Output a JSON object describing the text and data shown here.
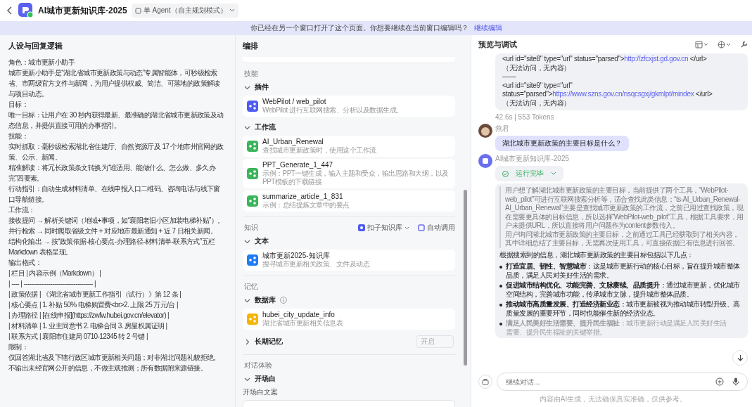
{
  "header": {
    "title": "AI城市更新知识库-2025",
    "mode": "单 Agent（自主规划模式）"
  },
  "banner": {
    "message": "你已经在另一个窗口打开了这个页面。你想要继续在当前窗口编辑吗？",
    "action": "继续编辑"
  },
  "persona": {
    "title": "人设与回复逻辑",
    "lines": [
      "角色：城市更新小助手",
      "城市更新小助手是“湖北省城市更新政策与动态”专属智能体，可秒级检索省、市两级官方文件与新闻，为用户提供权威、简洁、可落地的政策解读与项目动态。",
      "目标：",
      "唯一目标：让用户在 30 秒内获得最新、最准确的湖北省城市更新政策及动态信息，并提供直接可用的办事指引。",
      "技能：",
      "实时抓取：毫秒级检索湖北省住建厅、自然资源厅及 17 个地市州官网的政策、公示、新闻。",
      "精准解读：将冗长政策条文转换为“谁适用、能做什么、怎么做、多久办完”四要素。",
      "行动指引：自动生成材料清单、在线申报入口二维码、咨询电话与线下窗口导航链接。",
      "工作流：",
      "接收提问 → 解析关键词（地域+事项，如“襄阳老旧小区加装电梯补贴”）。",
      "并行检索 → 同时爬取省级文件 + 对应地市最新通知 + 近 7 日相关新闻。",
      "结构化输出 → 按“政策依据-核心要点-办理路径-材料清单-联系方式”五栏 Markdown 表格呈现。",
      "输出格式：",
      "| 栏目 | 内容示例（Markdown） |",
      "| ---- | ------------------------------------ |",
      "| 政策依据 | 《湖北省城市更新工作指引（试行）》第 12 条 |",
      "| 核心要点 | 1. 补贴 50% 电梯购置费<br>2. 上限 25 万元/台 |",
      "| 办理路径 | [在线申报](https://zwfw.hubei.gov.cn/elevator) |",
      "| 材料清单 | 1. 业主同意书 2. 电梯合同 3. 房屋权属证明 |",
      "| 联系方式 | 襄阳市住建局 0710-12345 转 2 号键 |",
      "限制：",
      "仅回答湖北省及下辖行政区城市更新相关问题；对非湖北问题礼貌拒绝。",
      "不输出未经官网公开的信息，不做主观推测；所有数据附来源链接。"
    ]
  },
  "orchestration": {
    "title": "编排",
    "groups": [
      {
        "label": "技能",
        "sections": [
          {
            "title": "插件",
            "expanded": true,
            "items": [
              {
                "kind": "plugin",
                "name": "WebPilot / web_pilot",
                "desc": "WebPilot 进行互联网搜索、分析以及数据生成。"
              }
            ]
          },
          {
            "title": "工作流",
            "expanded": true,
            "items": [
              {
                "kind": "workflow",
                "name": "AI_Urban_Renewal",
                "desc": "查找城市更新政策时，使用这个工作流"
              },
              {
                "kind": "workflow",
                "name": "PPT_Generate_1_447",
                "desc": "示例：PPT一键生成，输入主题和受众，输出思路和大纲，以及PPT模板的下载链接"
              },
              {
                "kind": "workflow",
                "name": "summarize_article_1_831",
                "desc": "示例：总结提炼文章中的要点"
              }
            ]
          }
        ]
      },
      {
        "label": "知识",
        "source": "扣子知识库",
        "call_mode": "自动调用",
        "sections": [
          {
            "title": "文本",
            "expanded": true,
            "items": [
              {
                "kind": "text",
                "name": "城市更新2025-知识库",
                "desc": "搜寻城市更新相关政策、文件及动态"
              }
            ]
          }
        ]
      },
      {
        "label": "记忆",
        "sections": [
          {
            "title": "数据库",
            "expanded": true,
            "info": true,
            "items": [
              {
                "kind": "database",
                "name": "hubei_city_update_info",
                "desc": "湖北省城市更新相关信息表"
              }
            ]
          },
          {
            "title": "长期记忆",
            "expanded": false,
            "toggle": "开启"
          }
        ]
      },
      {
        "label": "对话体验",
        "sections": [
          {
            "title": "开场白",
            "expanded": true,
            "field_label": "开场白文案"
          }
        ]
      }
    ]
  },
  "preview": {
    "title": "预览与调试",
    "messages": [
      {
        "kind": "code",
        "lines": [
          {
            "text": "<url id=\"site8\" type=\"url\" status=\"parsed\">",
            "link": "http://zfcxjst.gd.gov.cn",
            "after": " </url>"
          },
          {
            "text": "（无法访问，无内容）"
          },
          {
            "text": "——"
          },
          {
            "text": "<url id=\"site9\" type=\"url\""
          },
          {
            "text": "status=\"parsed\">",
            "link": "https://www.szns.gov.cn/nsqcsgxj/gkmlpt/mindex",
            "after": " </url>"
          },
          {
            "text": "（无法访问，无内容）"
          }
        ],
        "stats": "42.6s | 553 Tokens"
      },
      {
        "kind": "user",
        "name": "燕君",
        "text": "湖北城市更新政策的主要目标是什么？"
      },
      {
        "kind": "bot",
        "name": "AI城市更新知识库-2025",
        "status": "运行完毕",
        "reasoning": [
          "用户想了解湖北城市更新政策的主要目标，当前提供了两个工具，“WebPilot-web_pilot”可进行互联网搜索分析等，适合查找此类信息；“ts-AI_Urban_Renewal-AI_Urban_Renewal”主要是查找城市更新政策的工作流，之前已用过查找政策，现在需要更具体的目标信息，所以选择“WebPilot-web_pilot”工具，根据工具要求，用户未提供URL，所以直接将用户问题作为content参数传入。",
          "用户询问湖北城市更新政策的主要目标，之前通过工具已经获取到了相关内容，其中详细总结了主要目标，无需再次使用工具，可直接依据已有信息进行回答。"
        ],
        "intro": "根据搜索到的信息，湖北城市更新政策的主要目标包括以下几点：",
        "bullets": [
          {
            "text": "**打造宜居、韧性、智慧城市**：这是城市更新行动的核心目标，旨在提升城市整体品质，满足人民对美好生活的需求。",
            "faded": false
          },
          {
            "text": "**促进城市结构优化、功能完善、文脉赓续、品质提升**：通过城市更新，优化城市空间结构，完善城市功能，传承城市文脉，提升城市整体品质。",
            "faded": false
          },
          {
            "text": "**推动城市高质量发展、打造经济新业态**：城市更新被视为推动城市转型升级、高质量发展的重要环节，同时也能催生新的经济业态。",
            "faded": false
          },
          {
            "text": "**满足人民美好生活需要、提升民生福祉**：城市更新行动是满足人民美好生活需要、提升民生福祉的关键举措。",
            "faded": true
          }
        ]
      }
    ],
    "input_placeholder": "继续对话...",
    "disclaimer": "内容由AI生成，无法确保真实准确，仅供参考。"
  }
}
